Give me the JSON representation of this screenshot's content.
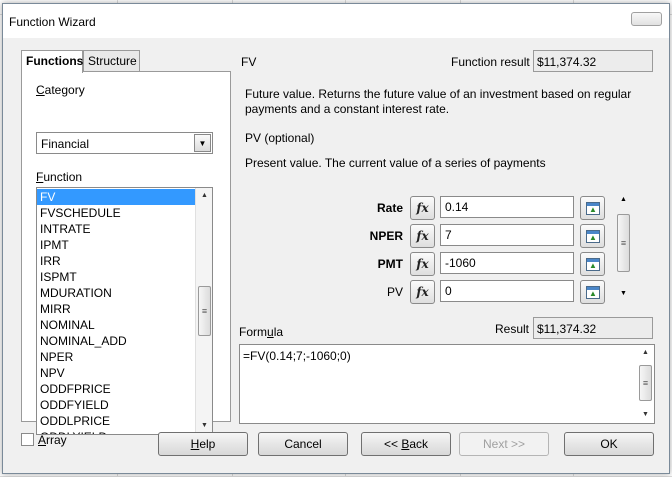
{
  "window": {
    "title": "Function Wizard",
    "close_glyph": "✕"
  },
  "tabs": [
    {
      "label": "Functions",
      "active": true
    },
    {
      "label": "Structure",
      "active": false
    }
  ],
  "category": {
    "label": "Category",
    "selected": "Financial"
  },
  "function_list": {
    "label": "Function",
    "items": [
      "FV",
      "FVSCHEDULE",
      "INTRATE",
      "IPMT",
      "IRR",
      "ISPMT",
      "MDURATION",
      "MIRR",
      "NOMINAL",
      "NOMINAL_ADD",
      "NPER",
      "NPV",
      "ODDFPRICE",
      "ODDFYIELD",
      "ODDLPRICE",
      "ODDLYIELD"
    ],
    "selected_index": 0
  },
  "function_info": {
    "name": "FV",
    "result_label": "Function result",
    "result_value": "$11,374.32",
    "description": "Future value. Returns the future value of an investment based on regular payments and a constant interest rate.",
    "arg_name": "PV (optional)",
    "arg_description": "Present value. The current value of a series of payments"
  },
  "arguments": [
    {
      "label": "Rate",
      "value": "0.14",
      "bold": true
    },
    {
      "label": "NPER",
      "value": "7",
      "bold": true
    },
    {
      "label": "PMT",
      "value": "-1060",
      "bold": true
    },
    {
      "label": "PV",
      "value": "0",
      "bold": false
    }
  ],
  "formula": {
    "label": "Formula",
    "result_label": "Result",
    "result_value": "$11,374.32",
    "text": "=FV(0.14;7;-1060;0)"
  },
  "array_checkbox": {
    "label": "Array",
    "checked": false
  },
  "buttons": {
    "help": "Help",
    "cancel": "Cancel",
    "back": "<< Back",
    "next": "Next >>",
    "ok": "OK"
  },
  "icons": {
    "fx": "fx",
    "scroll_up": "▲",
    "scroll_down": "▼",
    "combo_arrow": "▼",
    "grip": "≡"
  }
}
